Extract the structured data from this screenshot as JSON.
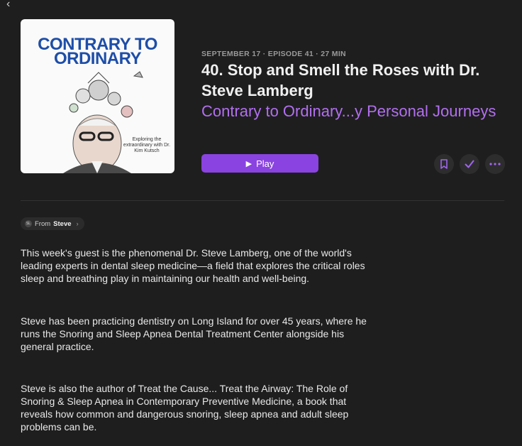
{
  "nav": {
    "back_glyph": "‹",
    "back_icon": "chevron-left-icon"
  },
  "artwork": {
    "title_line1": "CONTRARY TO",
    "title_line2": "ORDINARY",
    "subtitle": "Exploring the extraordinary with Dr. Kim Kutsch",
    "brand_color": "#1e4ea8"
  },
  "episode": {
    "meta": "SEPTEMBER 17 · EPISODE 41 · 27 MIN",
    "title": "40. Stop and Smell the Roses with Dr. Steve Lamberg",
    "show_name": "Contrary to Ordinary...y Personal Journeys"
  },
  "actions": {
    "play_label": "Play",
    "play_icon": "play-icon",
    "bookmark_icon": "bookmark-icon",
    "played_icon": "checkmark-icon",
    "more_icon": "more-icon"
  },
  "from_chip": {
    "prefix": "From",
    "name": "Steve",
    "avatar_initial": "SL"
  },
  "description": [
    "This week's guest is the phenomenal Dr. Steve Lamberg, one of the world's leading experts in dental sleep medicine—a field that explores the critical roles sleep and breathing play in maintaining our health and well-being.",
    "Steve has been practicing dentistry on Long Island for over 45 years, where he runs the Snoring and Sleep Apnea Dental Treatment Center alongside his general practice.",
    "Steve is also the author of Treat the Cause... Treat the Airway: The Role of Snoring & Sleep Apnea in Contemporary Preventive Medicine, a book that reveals how common and dangerous snoring, sleep apnea and adult sleep problems can be."
  ],
  "colors": {
    "accent": "#8a43e0",
    "link": "#b26ff0",
    "background": "#1e1e1e"
  }
}
